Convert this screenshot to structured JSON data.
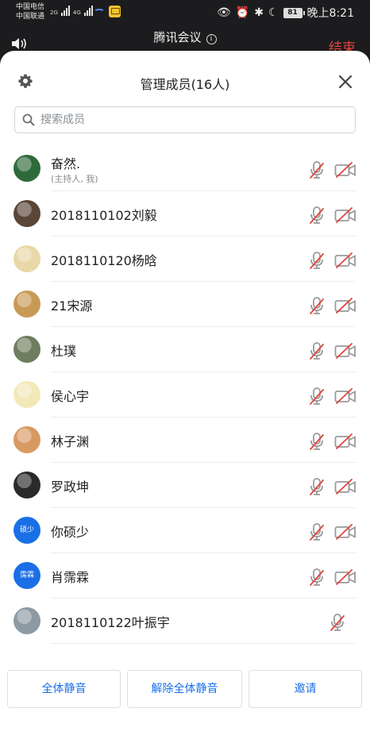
{
  "status_bar": {
    "carrier_1": "中国电信",
    "carrier_2": "中国联通",
    "net_1": "2G",
    "net_2": "4G",
    "battery": "81",
    "time": "晚上8:21"
  },
  "meeting": {
    "title": "腾讯会议",
    "end_label": "结束"
  },
  "sheet": {
    "title": "管理成员(16人)",
    "search_placeholder": "搜索成员"
  },
  "members": [
    {
      "name": "奋然.",
      "sub": "(主持人, 我)",
      "avatar_type": "image",
      "avatar_color": "#2f6b3a",
      "mic": "muted",
      "camera": "off"
    },
    {
      "name": "2018110102刘毅",
      "avatar_type": "image",
      "avatar_color": "#5a4637",
      "mic": "muted",
      "camera": "off"
    },
    {
      "name": "2018110120杨晗",
      "avatar_type": "image",
      "avatar_color": "#e9d7a8",
      "mic": "muted",
      "camera": "off"
    },
    {
      "name": "21宋源",
      "avatar_type": "image",
      "avatar_color": "#c99a55",
      "mic": "muted",
      "camera": "off"
    },
    {
      "name": "杜璞",
      "avatar_type": "image",
      "avatar_color": "#6e7d5d",
      "mic": "muted",
      "camera": "off"
    },
    {
      "name": "侯心宇",
      "avatar_type": "image",
      "avatar_color": "#f3e9b8",
      "mic": "muted",
      "camera": "off"
    },
    {
      "name": "林子渊",
      "avatar_type": "image",
      "avatar_color": "#d89a63",
      "mic": "muted",
      "camera": "off"
    },
    {
      "name": "罗政坤",
      "avatar_type": "image",
      "avatar_color": "#2a2a2a",
      "mic": "muted",
      "camera": "off"
    },
    {
      "name": "你硕少",
      "avatar_type": "text",
      "avatar_text": "硕少",
      "mic": "muted",
      "camera": "off"
    },
    {
      "name": "肖霈霖",
      "avatar_type": "text",
      "avatar_text": "霈霖",
      "mic": "muted",
      "camera": "off"
    },
    {
      "name": "2018110122叶振宇",
      "avatar_type": "image",
      "avatar_color": "#8d9aa3",
      "mic": "muted",
      "camera": "none"
    }
  ],
  "actions": {
    "mute_all": "全体静音",
    "unmute_all": "解除全体静音",
    "invite": "邀请"
  },
  "colors": {
    "accent": "#1a6fe6",
    "muted_red": "#e0433b",
    "icon_gray": "#9a9a9a",
    "end_red": "#e0433b"
  }
}
